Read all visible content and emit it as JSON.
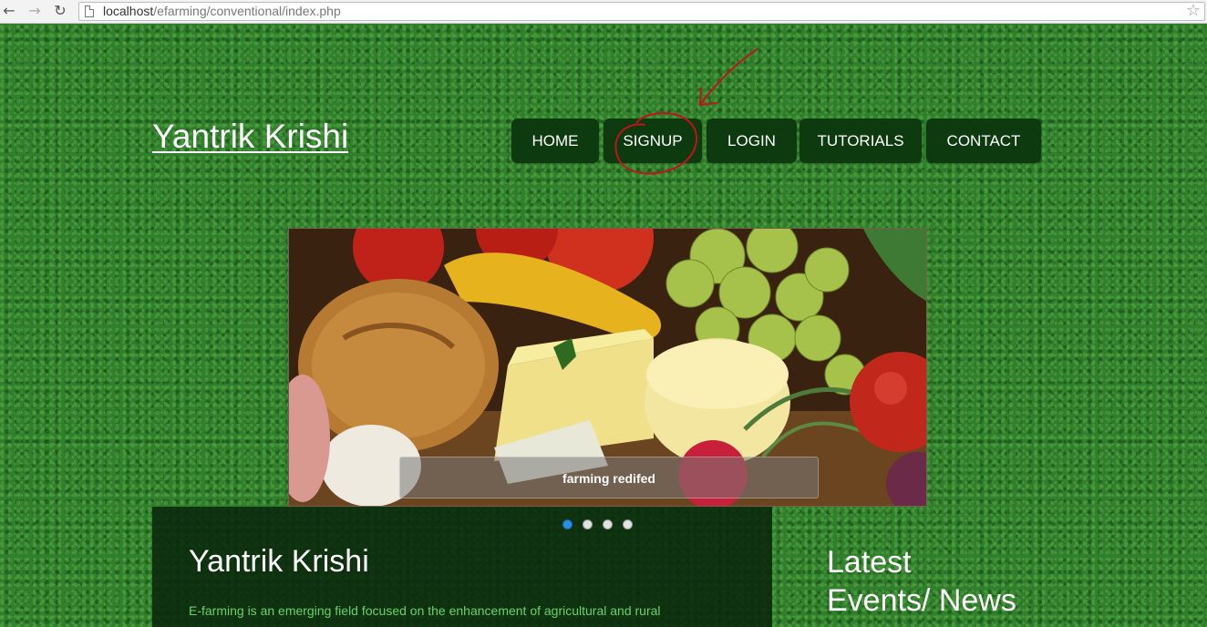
{
  "browser": {
    "url_host": "localhost",
    "url_path": "/efarming/conventional/index.php",
    "back_icon": "←",
    "forward_icon": "→",
    "reload_icon": "↻",
    "star_icon": "☆"
  },
  "site": {
    "logo": "Yantrik Krishi"
  },
  "nav": {
    "items": [
      {
        "label": "HOME"
      },
      {
        "label": "SIGNUP"
      },
      {
        "label": "LOGIN"
      },
      {
        "label": "TUTORIALS"
      },
      {
        "label": "CONTACT"
      }
    ]
  },
  "slider": {
    "caption": "farming redifed",
    "dot_count": 4,
    "active_index": 0
  },
  "main": {
    "title": "Yantrik Krishi",
    "text": "E-farming is an emerging field focused on the enhancement of agricultural and rural"
  },
  "news": {
    "heading_line1": "Latest",
    "heading_line2": "Events/ News"
  },
  "colors": {
    "nav_bg": "#0d3a0f",
    "annotation": "#c0141a",
    "body_text": "#6bd16b"
  }
}
